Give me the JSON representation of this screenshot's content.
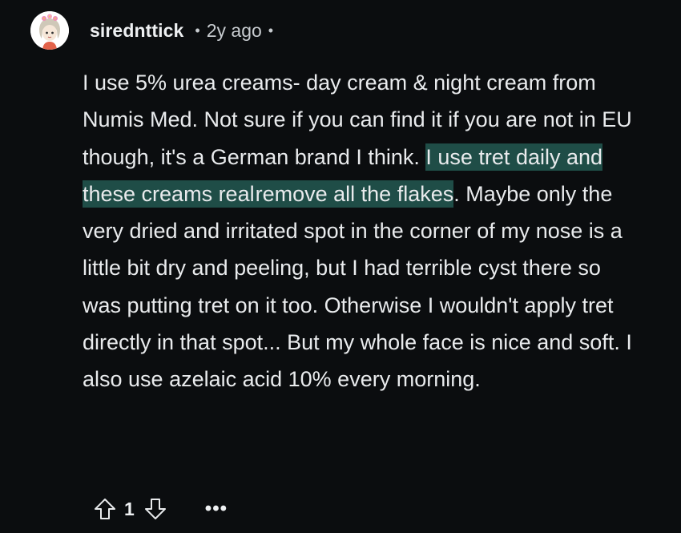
{
  "comment": {
    "author": "sirednttick",
    "separator": "•",
    "timestamp": "2y ago",
    "body_before": "I use 5% urea creams- day cream & night cream from Numis Med. Not sure if you can find it if you are not in EU though, it's a German brand I think. ",
    "highlighted_1": "I use tret daily and these creams really",
    "highlighted_2": "remove all the flakes",
    "body_after": ". Maybe only the very dried and irritated spot in the corner of my nose is a little bit dry and peeling, but I had terrible cyst there so was putting tret on it too. Otherwise I wouldn't apply tret directly in that spot... But my whole face is nice and soft. I also use azelaic acid 10% every morning.",
    "highlight_color": "#1f4d47"
  },
  "actions": {
    "upvote_icon": "arrow-up-outline-icon",
    "vote_count": "1",
    "downvote_icon": "arrow-down-outline-icon",
    "more_label": "•••"
  },
  "colors": {
    "background": "#0b0d0f",
    "text": "#e9ebed",
    "meta": "#c8ccd0"
  }
}
